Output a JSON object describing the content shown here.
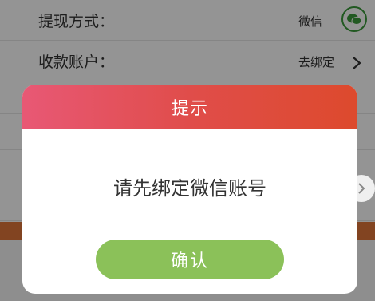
{
  "background": {
    "withdraw_method_label": "提现方式：",
    "withdraw_method_value": "微信",
    "account_label": "收款账户：",
    "account_value": "去绑定"
  },
  "dialog": {
    "title": "提示",
    "message": "请先绑定微信账号",
    "confirm_label": "确认"
  },
  "colors": {
    "header_gradient_start": "#e85875",
    "header_gradient_end": "#dd4a2d",
    "confirm_button": "#8bc159",
    "wechat_green": "#3c9a3c"
  },
  "icons": [
    "wechat-icon",
    "chevron-right-icon",
    "carousel-next-icon"
  ]
}
